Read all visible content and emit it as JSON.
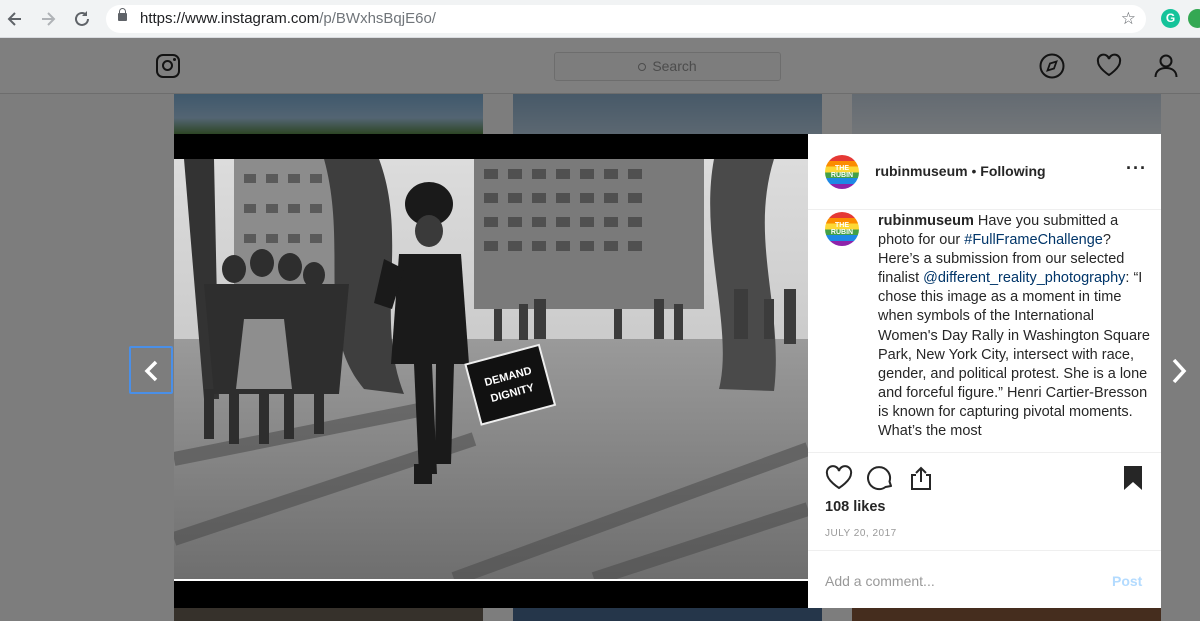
{
  "browser": {
    "url_host": "https://www.instagram.com",
    "url_path": "/p/BWxhsBqjE6o/",
    "extension_label": "G"
  },
  "instagram_header": {
    "search_placeholder": "Search"
  },
  "post": {
    "image_sign_text": "DEMAND DIGNITY",
    "username": "rubinmuseum",
    "avatar_label": "THE RUBIN",
    "follow_separator": "•",
    "follow_status": "Following",
    "caption_username": "rubinmuseum",
    "caption_text_1": " Have you submitted a photo for our ",
    "caption_hashtag": "#FullFrameChallenge",
    "caption_text_2": "? Here’s a submission from our selected finalist ",
    "caption_mention": "@different_reality_photography",
    "caption_text_3": ": “I chose this image as a moment in time when symbols of the International Women's Day Rally in Washington Square Park, New York City, intersect with race, gender, and political protest. She is a lone and forceful figure.” Henri Cartier-Bresson is known for capturing pivotal moments. What’s the most",
    "likes": "108 likes",
    "date": "JULY 20, 2017",
    "comment_placeholder": "Add a comment...",
    "post_label": "Post"
  }
}
